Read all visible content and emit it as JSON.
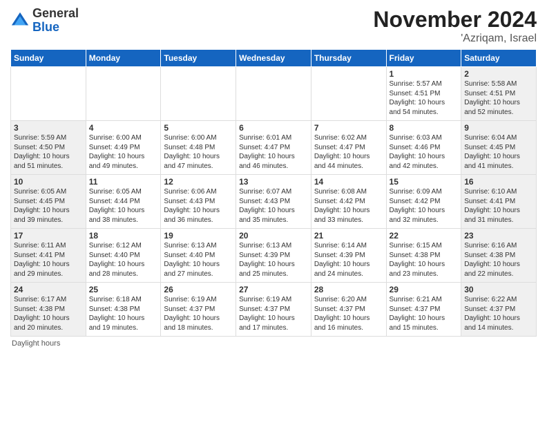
{
  "header": {
    "logo_general": "General",
    "logo_blue": "Blue",
    "month": "November 2024",
    "location": "'Azriqam, Israel"
  },
  "footer": {
    "daylight_label": "Daylight hours"
  },
  "days_of_week": [
    "Sunday",
    "Monday",
    "Tuesday",
    "Wednesday",
    "Thursday",
    "Friday",
    "Saturday"
  ],
  "weeks": [
    [
      {
        "day": "",
        "info": ""
      },
      {
        "day": "",
        "info": ""
      },
      {
        "day": "",
        "info": ""
      },
      {
        "day": "",
        "info": ""
      },
      {
        "day": "",
        "info": ""
      },
      {
        "day": "1",
        "info": "Sunrise: 5:57 AM\nSunset: 4:51 PM\nDaylight: 10 hours and 54 minutes."
      },
      {
        "day": "2",
        "info": "Sunrise: 5:58 AM\nSunset: 4:51 PM\nDaylight: 10 hours and 52 minutes."
      }
    ],
    [
      {
        "day": "3",
        "info": "Sunrise: 5:59 AM\nSunset: 4:50 PM\nDaylight: 10 hours and 51 minutes."
      },
      {
        "day": "4",
        "info": "Sunrise: 6:00 AM\nSunset: 4:49 PM\nDaylight: 10 hours and 49 minutes."
      },
      {
        "day": "5",
        "info": "Sunrise: 6:00 AM\nSunset: 4:48 PM\nDaylight: 10 hours and 47 minutes."
      },
      {
        "day": "6",
        "info": "Sunrise: 6:01 AM\nSunset: 4:47 PM\nDaylight: 10 hours and 46 minutes."
      },
      {
        "day": "7",
        "info": "Sunrise: 6:02 AM\nSunset: 4:47 PM\nDaylight: 10 hours and 44 minutes."
      },
      {
        "day": "8",
        "info": "Sunrise: 6:03 AM\nSunset: 4:46 PM\nDaylight: 10 hours and 42 minutes."
      },
      {
        "day": "9",
        "info": "Sunrise: 6:04 AM\nSunset: 4:45 PM\nDaylight: 10 hours and 41 minutes."
      }
    ],
    [
      {
        "day": "10",
        "info": "Sunrise: 6:05 AM\nSunset: 4:45 PM\nDaylight: 10 hours and 39 minutes."
      },
      {
        "day": "11",
        "info": "Sunrise: 6:05 AM\nSunset: 4:44 PM\nDaylight: 10 hours and 38 minutes."
      },
      {
        "day": "12",
        "info": "Sunrise: 6:06 AM\nSunset: 4:43 PM\nDaylight: 10 hours and 36 minutes."
      },
      {
        "day": "13",
        "info": "Sunrise: 6:07 AM\nSunset: 4:43 PM\nDaylight: 10 hours and 35 minutes."
      },
      {
        "day": "14",
        "info": "Sunrise: 6:08 AM\nSunset: 4:42 PM\nDaylight: 10 hours and 33 minutes."
      },
      {
        "day": "15",
        "info": "Sunrise: 6:09 AM\nSunset: 4:42 PM\nDaylight: 10 hours and 32 minutes."
      },
      {
        "day": "16",
        "info": "Sunrise: 6:10 AM\nSunset: 4:41 PM\nDaylight: 10 hours and 31 minutes."
      }
    ],
    [
      {
        "day": "17",
        "info": "Sunrise: 6:11 AM\nSunset: 4:41 PM\nDaylight: 10 hours and 29 minutes."
      },
      {
        "day": "18",
        "info": "Sunrise: 6:12 AM\nSunset: 4:40 PM\nDaylight: 10 hours and 28 minutes."
      },
      {
        "day": "19",
        "info": "Sunrise: 6:13 AM\nSunset: 4:40 PM\nDaylight: 10 hours and 27 minutes."
      },
      {
        "day": "20",
        "info": "Sunrise: 6:13 AM\nSunset: 4:39 PM\nDaylight: 10 hours and 25 minutes."
      },
      {
        "day": "21",
        "info": "Sunrise: 6:14 AM\nSunset: 4:39 PM\nDaylight: 10 hours and 24 minutes."
      },
      {
        "day": "22",
        "info": "Sunrise: 6:15 AM\nSunset: 4:38 PM\nDaylight: 10 hours and 23 minutes."
      },
      {
        "day": "23",
        "info": "Sunrise: 6:16 AM\nSunset: 4:38 PM\nDaylight: 10 hours and 22 minutes."
      }
    ],
    [
      {
        "day": "24",
        "info": "Sunrise: 6:17 AM\nSunset: 4:38 PM\nDaylight: 10 hours and 20 minutes."
      },
      {
        "day": "25",
        "info": "Sunrise: 6:18 AM\nSunset: 4:38 PM\nDaylight: 10 hours and 19 minutes."
      },
      {
        "day": "26",
        "info": "Sunrise: 6:19 AM\nSunset: 4:37 PM\nDaylight: 10 hours and 18 minutes."
      },
      {
        "day": "27",
        "info": "Sunrise: 6:19 AM\nSunset: 4:37 PM\nDaylight: 10 hours and 17 minutes."
      },
      {
        "day": "28",
        "info": "Sunrise: 6:20 AM\nSunset: 4:37 PM\nDaylight: 10 hours and 16 minutes."
      },
      {
        "day": "29",
        "info": "Sunrise: 6:21 AM\nSunset: 4:37 PM\nDaylight: 10 hours and 15 minutes."
      },
      {
        "day": "30",
        "info": "Sunrise: 6:22 AM\nSunset: 4:37 PM\nDaylight: 10 hours and 14 minutes."
      }
    ]
  ]
}
